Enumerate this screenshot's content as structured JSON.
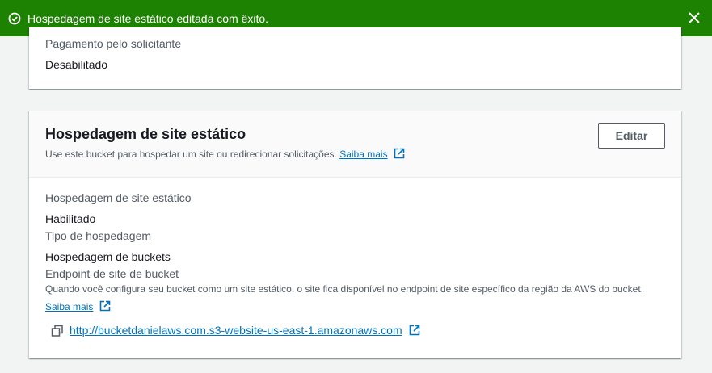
{
  "flash": {
    "message": "Hospedagem de site estático editada com êxito.",
    "icon": "check-circle-icon",
    "close_icon": "close-icon",
    "color": "#1d8102"
  },
  "requester_pays": {
    "label": "Pagamento pelo solicitante",
    "value": "Desabilitado"
  },
  "static_hosting": {
    "title": "Hospedagem de site estático",
    "description": "Use este bucket para hospedar um site ou redirecionar solicitações.",
    "learn_more": "Saiba mais",
    "edit_button": "Editar",
    "status_label": "Hospedagem de site estático",
    "status_value": "Habilitado",
    "type_label": "Tipo de hospedagem",
    "type_value": "Hospedagem de buckets",
    "endpoint_label": "Endpoint de site de bucket",
    "endpoint_description": "Quando você configura seu bucket como um site estático, o site fica disponível no endpoint de site específico da região da AWS do bucket.",
    "endpoint_learn_more": "Saiba mais",
    "endpoint_url": "http://bucketdanielaws.com.s3-website-us-east-1.amazonaws.com",
    "link_color": "#0073bb"
  }
}
